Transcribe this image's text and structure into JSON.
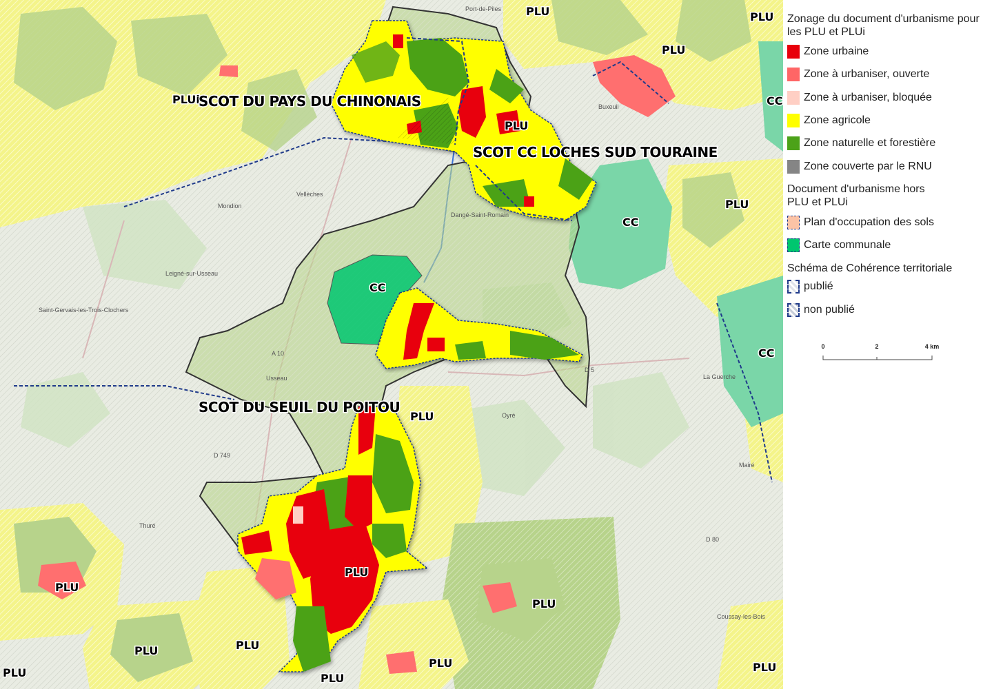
{
  "map": {
    "plu_labels": [
      "PLU",
      "PLU",
      "PLU",
      "PLU",
      "PLU",
      "PLU",
      "PLU",
      "PLU",
      "PLU",
      "PLU",
      "PLU",
      "PLU",
      "PLU"
    ],
    "pluI_label": "PLUi",
    "cc_labels": [
      "CC",
      "CC",
      "CC",
      "CC"
    ],
    "scot_labels": [
      "SCOT DU PAYS DU CHINONAIS",
      "SCOT CC LOCHES SUD TOURAINE",
      "SCOT DU SEUIL DU POITOU"
    ],
    "place_names": [
      "Port-de-Piles",
      "Buxeuil",
      "Vellèches",
      "Mondion",
      "Dangé-Saint-Romain",
      "Leigné-sur-Usseau",
      "Saint-Gervais-les-Trois-Clochers",
      "Usseau",
      "Oyré",
      "Thuré",
      "Mairé",
      "La Guerche",
      "Coussay-les-Bois"
    ],
    "road_labels": [
      "A 10",
      "D 749",
      "D 80",
      "D 5"
    ]
  },
  "legend": {
    "section1_title": "Zonage du document d'urbanisme pour les PLU et PLUi",
    "items1": [
      {
        "label": "Zone urbaine",
        "color": "#e8000b"
      },
      {
        "label": "Zone à urbaniser, ouverte",
        "color": "#ff6666"
      },
      {
        "label": "Zone à urbaniser, bloquée",
        "color": "#ffcfc4"
      },
      {
        "label": "Zone agricole",
        "color": "#ffff00"
      },
      {
        "label": "Zone naturelle et forestière",
        "color": "#4ca219"
      },
      {
        "label": "Zone couverte par le RNU",
        "color": "#858585"
      }
    ],
    "section2_title": "Document d'urbanisme hors PLU et PLUi",
    "items2": [
      {
        "label": "Plan d'occupation des sols",
        "color": "#fcc3a6"
      },
      {
        "label": "Carte communale",
        "color": "#00c66f"
      }
    ],
    "section3_title": "Schéma de Cohérence territoriale",
    "items3": [
      {
        "label": "publié",
        "color": "#1f3a8a"
      },
      {
        "label": "non publié",
        "color": "#1f3a8a"
      }
    ]
  },
  "scale": {
    "labels": [
      "0",
      "2",
      "4 km"
    ]
  }
}
